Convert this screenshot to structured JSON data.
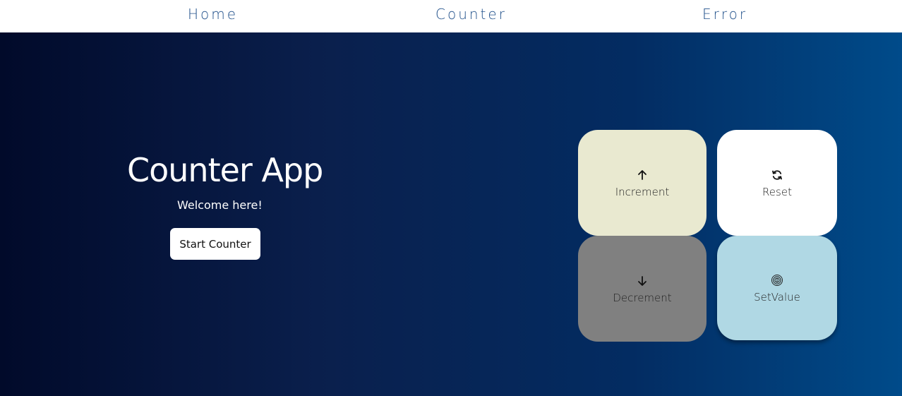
{
  "nav": {
    "items": [
      {
        "label": "Home"
      },
      {
        "label": "Counter"
      },
      {
        "label": "Error"
      }
    ]
  },
  "hero": {
    "title": "Counter App",
    "subtitle": "Welcome here!",
    "start_button": "Start Counter"
  },
  "tiles": {
    "increment": {
      "label": "Increment",
      "icon": "arrow-up-icon",
      "color": "#e9e9d0"
    },
    "reset": {
      "label": "Reset",
      "icon": "refresh-icon",
      "color": "#ffffff"
    },
    "decrement": {
      "label": "Decrement",
      "icon": "arrow-down-icon",
      "color": "#808080"
    },
    "setvalue": {
      "label": "SetValue",
      "icon": "fingerprint-icon",
      "color": "#b0d8e4"
    }
  },
  "colors": {
    "nav_text": "#1f4f8a",
    "hero_gradient_start": "#010a2a",
    "hero_gradient_end": "#004b8a"
  }
}
